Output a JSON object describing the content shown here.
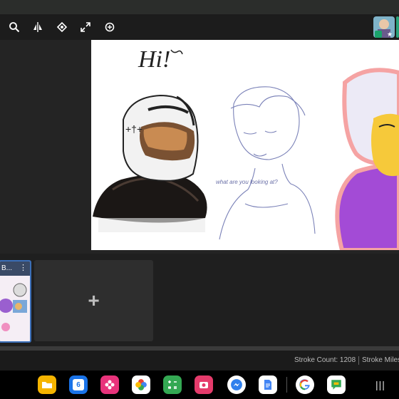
{
  "toolbar": {
    "tools": [
      {
        "icon": "zoom-icon"
      },
      {
        "icon": "symmetry-icon"
      },
      {
        "icon": "reference-icon"
      },
      {
        "icon": "fullscreen-icon"
      },
      {
        "icon": "transform-icon"
      }
    ]
  },
  "canvas": {
    "handwritten_greeting": "Hi!",
    "sketch_note": "what are you looking at?"
  },
  "timeline": {
    "frames": [
      {
        "label": "B..."
      }
    ],
    "add_frame_symbol": "+"
  },
  "status": {
    "stroke_count": "Stroke Count: 1208",
    "stroke_miles": "Stroke Miles"
  },
  "dock": {
    "apps": [
      {
        "name": "files",
        "color": "#f5b400",
        "icon": "folder-icon"
      },
      {
        "name": "calendar",
        "color": "#1a73e8",
        "icon": "calendar-icon",
        "label": "6"
      },
      {
        "name": "flower",
        "color": "#e8337b",
        "icon": "flower-icon"
      },
      {
        "name": "photos",
        "color": "#ffffff",
        "icon": "photos-icon"
      },
      {
        "name": "calculator",
        "color": "#34a853",
        "icon": "calculator-icon"
      },
      {
        "name": "screen-recorder",
        "color": "#e53b6b",
        "icon": "recorder-icon"
      },
      {
        "name": "messenger",
        "color": "#ffffff",
        "icon": "messenger-icon"
      },
      {
        "name": "docs",
        "color": "#ffffff",
        "icon": "docs-icon"
      },
      {
        "name": "google",
        "color": "#ffffff",
        "icon": "google-icon"
      },
      {
        "name": "chat",
        "color": "#ffffff",
        "icon": "chat-icon"
      }
    ],
    "recents_glyph": "|||"
  },
  "colors": {
    "frame_border": "#3b6fb8",
    "purple_character": "#a34bd6"
  }
}
